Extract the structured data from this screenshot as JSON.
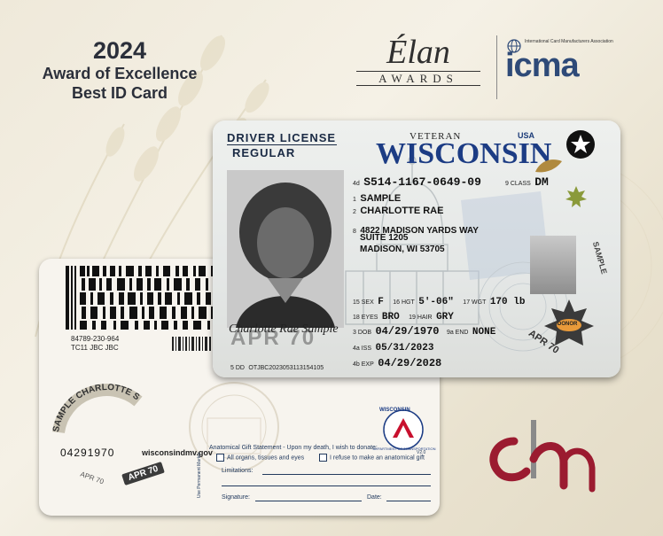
{
  "award": {
    "year": "2024",
    "line1": "Award of Excellence",
    "line2": "Best ID Card"
  },
  "elan": {
    "title": "Élan",
    "subtitle": "AWARDS"
  },
  "icma": {
    "association": "International Card Manufacturers Association",
    "logo": "icma"
  },
  "cbn": {
    "logo": "cbn"
  },
  "front": {
    "header_line1": "DRIVER LICENSE",
    "header_line2": "REGULAR",
    "veteran": "VETERAN",
    "state": "WISCONSIN",
    "country": "USA",
    "license_no_label": "4d",
    "license_no": "S514-1167-0649-09",
    "class_label": "9 CLASS",
    "class": "DM",
    "last_label": "1",
    "last_name": "SAMPLE",
    "first_label": "2",
    "first_name": "CHARLOTTE RAE",
    "addr_label": "8",
    "address1": "4822 MADISON YARDS WAY",
    "address2": "SUITE 1205",
    "address3": "MADISON, WI 53705",
    "sex_label": "15 SEX",
    "sex": "F",
    "hgt_label": "16 HGT",
    "height": "5'-06\"",
    "wgt_label": "17 WGT",
    "weight": "170 lb",
    "eyes_label": "18 EYES",
    "eyes": "BRO",
    "hair_label": "19 HAIR",
    "hair": "GRY",
    "dob_label": "3 DOB",
    "dob": "04/29/1970",
    "end_label": "9a END",
    "endorsement": "NONE",
    "iss_label": "4a ISS",
    "issued": "05/31/2023",
    "dd_label": "5 DD",
    "dd": "OTJBC2023053113154105",
    "exp_label": "4b EXP",
    "expires": "04/29/2028",
    "signature": "Charlotte Rae Sample",
    "ghost_text": "APR 70",
    "donor": "DONOR",
    "apr_diag": "APR 70",
    "side_text": "SAMPLE"
  },
  "back": {
    "bc_line1": "84789-230-964",
    "bc_line2": "TC11 JBC JBC",
    "arc_text": "SAMPLE CHARLOTTE SAMPLE",
    "number": "04291970",
    "website": "wisconsindmv.gov",
    "apr_a": "APR 70",
    "apr_b": "APR 70",
    "seal_top": "WISCONSIN",
    "seal_bottom": "DEPARTMENT OF TRANSPORTATION",
    "gift_statement": "Anatomical Gift Statement - Upon my death, I wish to donate:",
    "gift_version": "V2.0",
    "side_label": "Use Permanent Marker",
    "option1": "All organs, tissues and eyes",
    "option2": "I refuse to make an anatomical gift",
    "limitations": "Limitations:",
    "signature": "Signature:",
    "date": "Date:"
  },
  "colors": {
    "navy": "#1c3c84",
    "maroon": "#9b1b30",
    "gold": "#b08a3e"
  }
}
